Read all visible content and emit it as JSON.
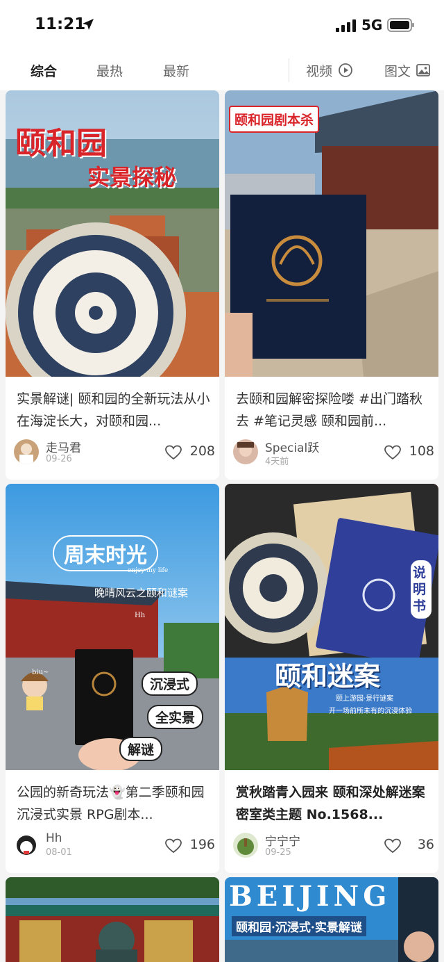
{
  "status": {
    "time": "11:21",
    "network": "5G"
  },
  "tabs": {
    "items": [
      "综合",
      "最热",
      "最新"
    ],
    "video": "视频",
    "image_text": "图文"
  },
  "cards": [
    {
      "overlay": [
        "颐和园",
        "实景探秘"
      ],
      "text": "实景解谜| 颐和园的全新玩法从小在海淀长大，对颐和园...",
      "user": "走马君",
      "date": "09-26",
      "likes": "208"
    },
    {
      "overlay": [
        "颐和园剧本杀"
      ],
      "text": "去颐和园解密探险喽 #出门踏秋去 #笔记灵感 颐和园前...",
      "user": "Special跃",
      "date": "4天前",
      "likes": "108"
    },
    {
      "overlay": [
        "周末时光",
        "晚晴风云之颐和谜案",
        "沉浸式",
        "全实景",
        "解谜",
        "enjoy my life",
        "Hh",
        "biu~"
      ],
      "text": "公园的新奇玩法👻第二季颐和园 沉浸式实景 RPG剧本...",
      "user": "Hh",
      "date": "08-01",
      "likes": "196"
    },
    {
      "overlay": [
        "颐和迷案",
        "说明书",
        "颐上游园·景行谜案",
        "开一场前所未有的沉浸体验"
      ],
      "text": "赏秋踏青入园来 颐和深处解迷案 密室类主题 No.1568...",
      "user": "宁宁宁",
      "date": "09-25",
      "likes": "36"
    },
    {
      "overlay": [
        "BEIJING",
        "颐和园·沉浸式·实景解谜"
      ]
    }
  ],
  "colors": {
    "accent": "#e0362c",
    "active_tab": "#222222"
  }
}
